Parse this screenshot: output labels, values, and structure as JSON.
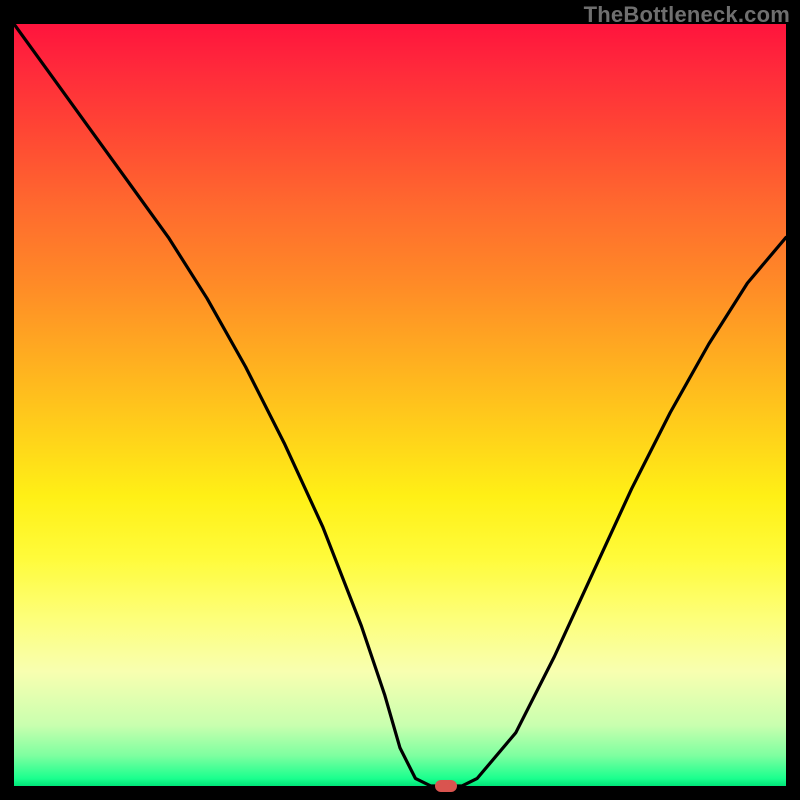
{
  "watermark": "TheBottleneck.com",
  "colors": {
    "frame": "#000000",
    "curve_stroke": "#000000",
    "marker_fill": "#d9544f",
    "watermark_text": "#6f6f6f"
  },
  "chart_data": {
    "type": "line",
    "title": "",
    "xlabel": "",
    "ylabel": "",
    "xlim": [
      0,
      100
    ],
    "ylim": [
      0,
      100
    ],
    "grid": false,
    "legend": false,
    "series": [
      {
        "name": "bottleneck-curve",
        "x": [
          0,
          5,
          10,
          15,
          20,
          25,
          30,
          35,
          40,
          45,
          48,
          50,
          52,
          54,
          56,
          58,
          60,
          65,
          70,
          75,
          80,
          85,
          90,
          95,
          100
        ],
        "values": [
          100,
          93,
          86,
          79,
          72,
          64,
          55,
          45,
          34,
          21,
          12,
          5,
          1,
          0,
          0,
          0,
          1,
          7,
          17,
          28,
          39,
          49,
          58,
          66,
          72
        ]
      }
    ],
    "annotations": [
      {
        "name": "optimal-point-marker",
        "x": 56,
        "y": 0,
        "shape": "pill",
        "color": "#d9544f"
      }
    ]
  }
}
